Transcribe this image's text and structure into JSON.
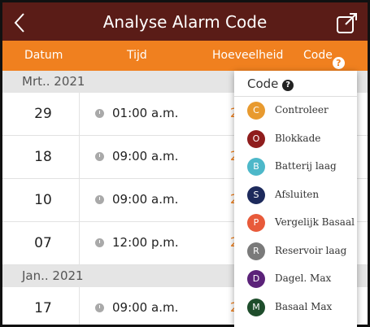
{
  "header": {
    "title": "Analyse Alarm Code",
    "back_icon": "chevron-left-icon",
    "export_icon": "export-icon"
  },
  "columns": {
    "date": "Datum",
    "time": "Tijd",
    "amount": "Hoeveelheid",
    "code": "Code",
    "code_help_icon": "question-icon"
  },
  "groups": [
    {
      "month": "Mrt.. 2021",
      "rows": [
        {
          "day": "29",
          "time": "01:00 a.m.",
          "amount": "2"
        },
        {
          "day": "18",
          "time": "09:00 a.m.",
          "amount": "2"
        },
        {
          "day": "10",
          "time": "09:00 a.m.",
          "amount": "2"
        },
        {
          "day": "07",
          "time": "12:00 p.m.",
          "amount": "2"
        }
      ]
    },
    {
      "month": "Jan.. 2021",
      "rows": [
        {
          "day": "17",
          "time": "09:00 a.m.",
          "amount": "2"
        }
      ]
    }
  ],
  "popup": {
    "title": "Code",
    "items": [
      {
        "letter": "C",
        "label": "Controleer",
        "color": "#e89a2f"
      },
      {
        "letter": "O",
        "label": "Blokkade",
        "color": "#8f1d1d"
      },
      {
        "letter": "B",
        "label": "Batterij laag",
        "color": "#4db8c9"
      },
      {
        "letter": "S",
        "label": "Afsluiten",
        "color": "#1d2a5c"
      },
      {
        "letter": "P",
        "label": "Vergelijk Basaal",
        "color": "#e85a3a"
      },
      {
        "letter": "R",
        "label": "Reservoir laag",
        "color": "#7a7a7a"
      },
      {
        "letter": "D",
        "label": "Dagel. Max",
        "color": "#5b2279"
      },
      {
        "letter": "M",
        "label": "Basaal Max",
        "color": "#1e4d2b"
      }
    ]
  },
  "colors": {
    "header": "#5a1c17",
    "accent": "#f0801f",
    "month_band": "#e5e5e5"
  }
}
